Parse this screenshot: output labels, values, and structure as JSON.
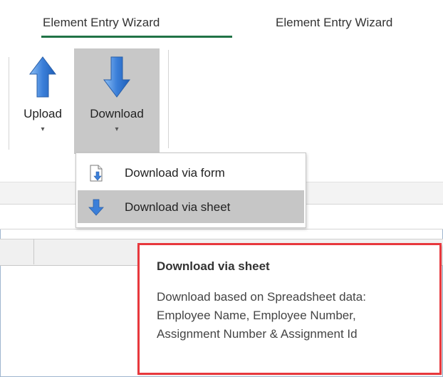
{
  "ribbon": {
    "tabs": [
      {
        "label": "Element Entry Wizard",
        "active": true
      },
      {
        "label": "Element Entry Wizard",
        "active": false
      }
    ],
    "buttons": {
      "upload": {
        "label": "Upload",
        "icon": "arrow-up-icon"
      },
      "download": {
        "label": "Download",
        "icon": "arrow-down-icon"
      }
    }
  },
  "menu": {
    "items": [
      {
        "label": "Download via form",
        "icon": "form-download-icon"
      },
      {
        "label": "Download via sheet",
        "icon": "arrow-down-icon",
        "highlighted": true
      }
    ]
  },
  "tooltip": {
    "title": "Download via sheet",
    "body": "Download based on Spreadsheet data: Employee Name, Employee Number, Assignment Number & Assignment Id"
  },
  "colors": {
    "active_tab_underline": "#217346",
    "highlight_border": "#e8383d",
    "pressed_button": "#c8c8c8",
    "arrow_blue": "#3b7fd9"
  }
}
